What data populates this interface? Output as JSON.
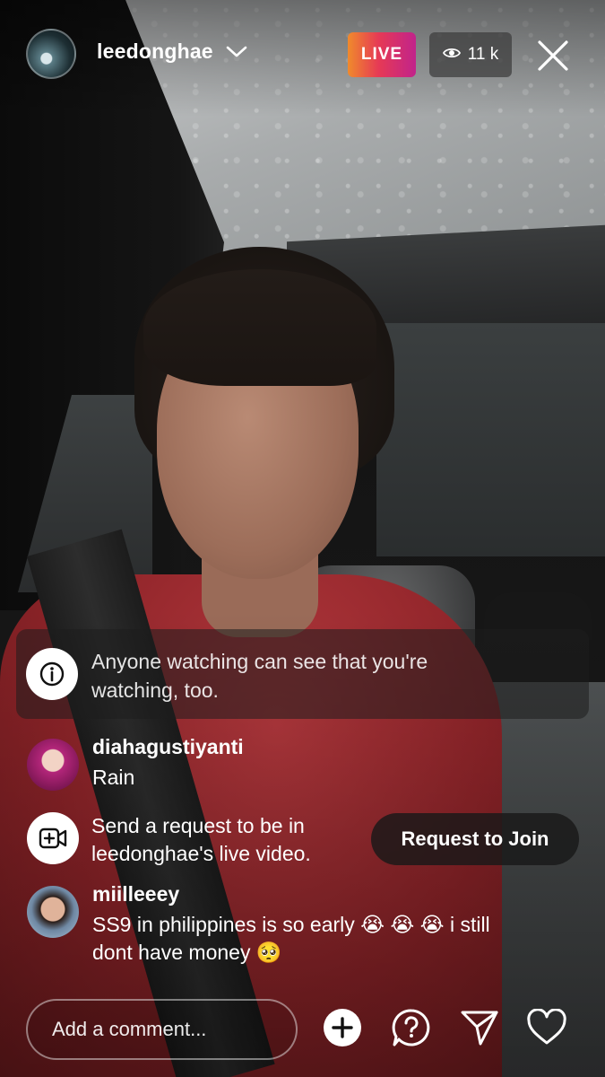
{
  "header": {
    "username": "leedonghae",
    "live_label": "LIVE",
    "viewer_count": "11 k"
  },
  "notice": {
    "text": "Anyone watching can see that you're watching, too."
  },
  "comments": [
    {
      "username": "diahagustiyanti",
      "text": "Rain"
    },
    {
      "username": "miilleeey",
      "text": "SS9 in philippines is so early 😭 😭 😭 i still dont have money 🥺"
    }
  ],
  "join_request": {
    "text": "Send a request to be in leedonghae's live video.",
    "button_label": "Request to Join"
  },
  "composer": {
    "placeholder": "Add a comment..."
  },
  "icons": {
    "header": [
      "avatar",
      "chevron-down-icon",
      "eye-icon",
      "close-icon"
    ],
    "notice": "info-icon",
    "join": "video-camera-plus-icon",
    "bottom_bar": [
      "plus-circle-icon",
      "question-icon",
      "send-icon",
      "heart-icon"
    ]
  },
  "colors": {
    "live_gradient": [
      "#f08a2c",
      "#e63a55",
      "#c1238b"
    ],
    "viewer_badge": "#3c3c3c",
    "text": "#ffffff"
  }
}
